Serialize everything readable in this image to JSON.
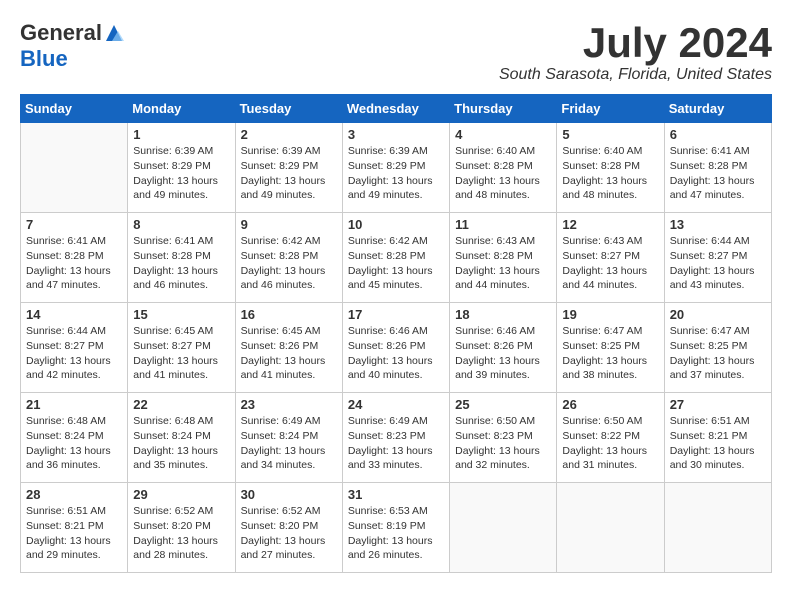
{
  "header": {
    "logo_general": "General",
    "logo_blue": "Blue",
    "month_title": "July 2024",
    "location": "South Sarasota, Florida, United States"
  },
  "weekdays": [
    "Sunday",
    "Monday",
    "Tuesday",
    "Wednesday",
    "Thursday",
    "Friday",
    "Saturday"
  ],
  "weeks": [
    [
      {
        "day": "",
        "info": ""
      },
      {
        "day": "1",
        "info": "Sunrise: 6:39 AM\nSunset: 8:29 PM\nDaylight: 13 hours\nand 49 minutes."
      },
      {
        "day": "2",
        "info": "Sunrise: 6:39 AM\nSunset: 8:29 PM\nDaylight: 13 hours\nand 49 minutes."
      },
      {
        "day": "3",
        "info": "Sunrise: 6:39 AM\nSunset: 8:29 PM\nDaylight: 13 hours\nand 49 minutes."
      },
      {
        "day": "4",
        "info": "Sunrise: 6:40 AM\nSunset: 8:28 PM\nDaylight: 13 hours\nand 48 minutes."
      },
      {
        "day": "5",
        "info": "Sunrise: 6:40 AM\nSunset: 8:28 PM\nDaylight: 13 hours\nand 48 minutes."
      },
      {
        "day": "6",
        "info": "Sunrise: 6:41 AM\nSunset: 8:28 PM\nDaylight: 13 hours\nand 47 minutes."
      }
    ],
    [
      {
        "day": "7",
        "info": "Sunrise: 6:41 AM\nSunset: 8:28 PM\nDaylight: 13 hours\nand 47 minutes."
      },
      {
        "day": "8",
        "info": "Sunrise: 6:41 AM\nSunset: 8:28 PM\nDaylight: 13 hours\nand 46 minutes."
      },
      {
        "day": "9",
        "info": "Sunrise: 6:42 AM\nSunset: 8:28 PM\nDaylight: 13 hours\nand 46 minutes."
      },
      {
        "day": "10",
        "info": "Sunrise: 6:42 AM\nSunset: 8:28 PM\nDaylight: 13 hours\nand 45 minutes."
      },
      {
        "day": "11",
        "info": "Sunrise: 6:43 AM\nSunset: 8:28 PM\nDaylight: 13 hours\nand 44 minutes."
      },
      {
        "day": "12",
        "info": "Sunrise: 6:43 AM\nSunset: 8:27 PM\nDaylight: 13 hours\nand 44 minutes."
      },
      {
        "day": "13",
        "info": "Sunrise: 6:44 AM\nSunset: 8:27 PM\nDaylight: 13 hours\nand 43 minutes."
      }
    ],
    [
      {
        "day": "14",
        "info": "Sunrise: 6:44 AM\nSunset: 8:27 PM\nDaylight: 13 hours\nand 42 minutes."
      },
      {
        "day": "15",
        "info": "Sunrise: 6:45 AM\nSunset: 8:27 PM\nDaylight: 13 hours\nand 41 minutes."
      },
      {
        "day": "16",
        "info": "Sunrise: 6:45 AM\nSunset: 8:26 PM\nDaylight: 13 hours\nand 41 minutes."
      },
      {
        "day": "17",
        "info": "Sunrise: 6:46 AM\nSunset: 8:26 PM\nDaylight: 13 hours\nand 40 minutes."
      },
      {
        "day": "18",
        "info": "Sunrise: 6:46 AM\nSunset: 8:26 PM\nDaylight: 13 hours\nand 39 minutes."
      },
      {
        "day": "19",
        "info": "Sunrise: 6:47 AM\nSunset: 8:25 PM\nDaylight: 13 hours\nand 38 minutes."
      },
      {
        "day": "20",
        "info": "Sunrise: 6:47 AM\nSunset: 8:25 PM\nDaylight: 13 hours\nand 37 minutes."
      }
    ],
    [
      {
        "day": "21",
        "info": "Sunrise: 6:48 AM\nSunset: 8:24 PM\nDaylight: 13 hours\nand 36 minutes."
      },
      {
        "day": "22",
        "info": "Sunrise: 6:48 AM\nSunset: 8:24 PM\nDaylight: 13 hours\nand 35 minutes."
      },
      {
        "day": "23",
        "info": "Sunrise: 6:49 AM\nSunset: 8:24 PM\nDaylight: 13 hours\nand 34 minutes."
      },
      {
        "day": "24",
        "info": "Sunrise: 6:49 AM\nSunset: 8:23 PM\nDaylight: 13 hours\nand 33 minutes."
      },
      {
        "day": "25",
        "info": "Sunrise: 6:50 AM\nSunset: 8:23 PM\nDaylight: 13 hours\nand 32 minutes."
      },
      {
        "day": "26",
        "info": "Sunrise: 6:50 AM\nSunset: 8:22 PM\nDaylight: 13 hours\nand 31 minutes."
      },
      {
        "day": "27",
        "info": "Sunrise: 6:51 AM\nSunset: 8:21 PM\nDaylight: 13 hours\nand 30 minutes."
      }
    ],
    [
      {
        "day": "28",
        "info": "Sunrise: 6:51 AM\nSunset: 8:21 PM\nDaylight: 13 hours\nand 29 minutes."
      },
      {
        "day": "29",
        "info": "Sunrise: 6:52 AM\nSunset: 8:20 PM\nDaylight: 13 hours\nand 28 minutes."
      },
      {
        "day": "30",
        "info": "Sunrise: 6:52 AM\nSunset: 8:20 PM\nDaylight: 13 hours\nand 27 minutes."
      },
      {
        "day": "31",
        "info": "Sunrise: 6:53 AM\nSunset: 8:19 PM\nDaylight: 13 hours\nand 26 minutes."
      },
      {
        "day": "",
        "info": ""
      },
      {
        "day": "",
        "info": ""
      },
      {
        "day": "",
        "info": ""
      }
    ]
  ]
}
